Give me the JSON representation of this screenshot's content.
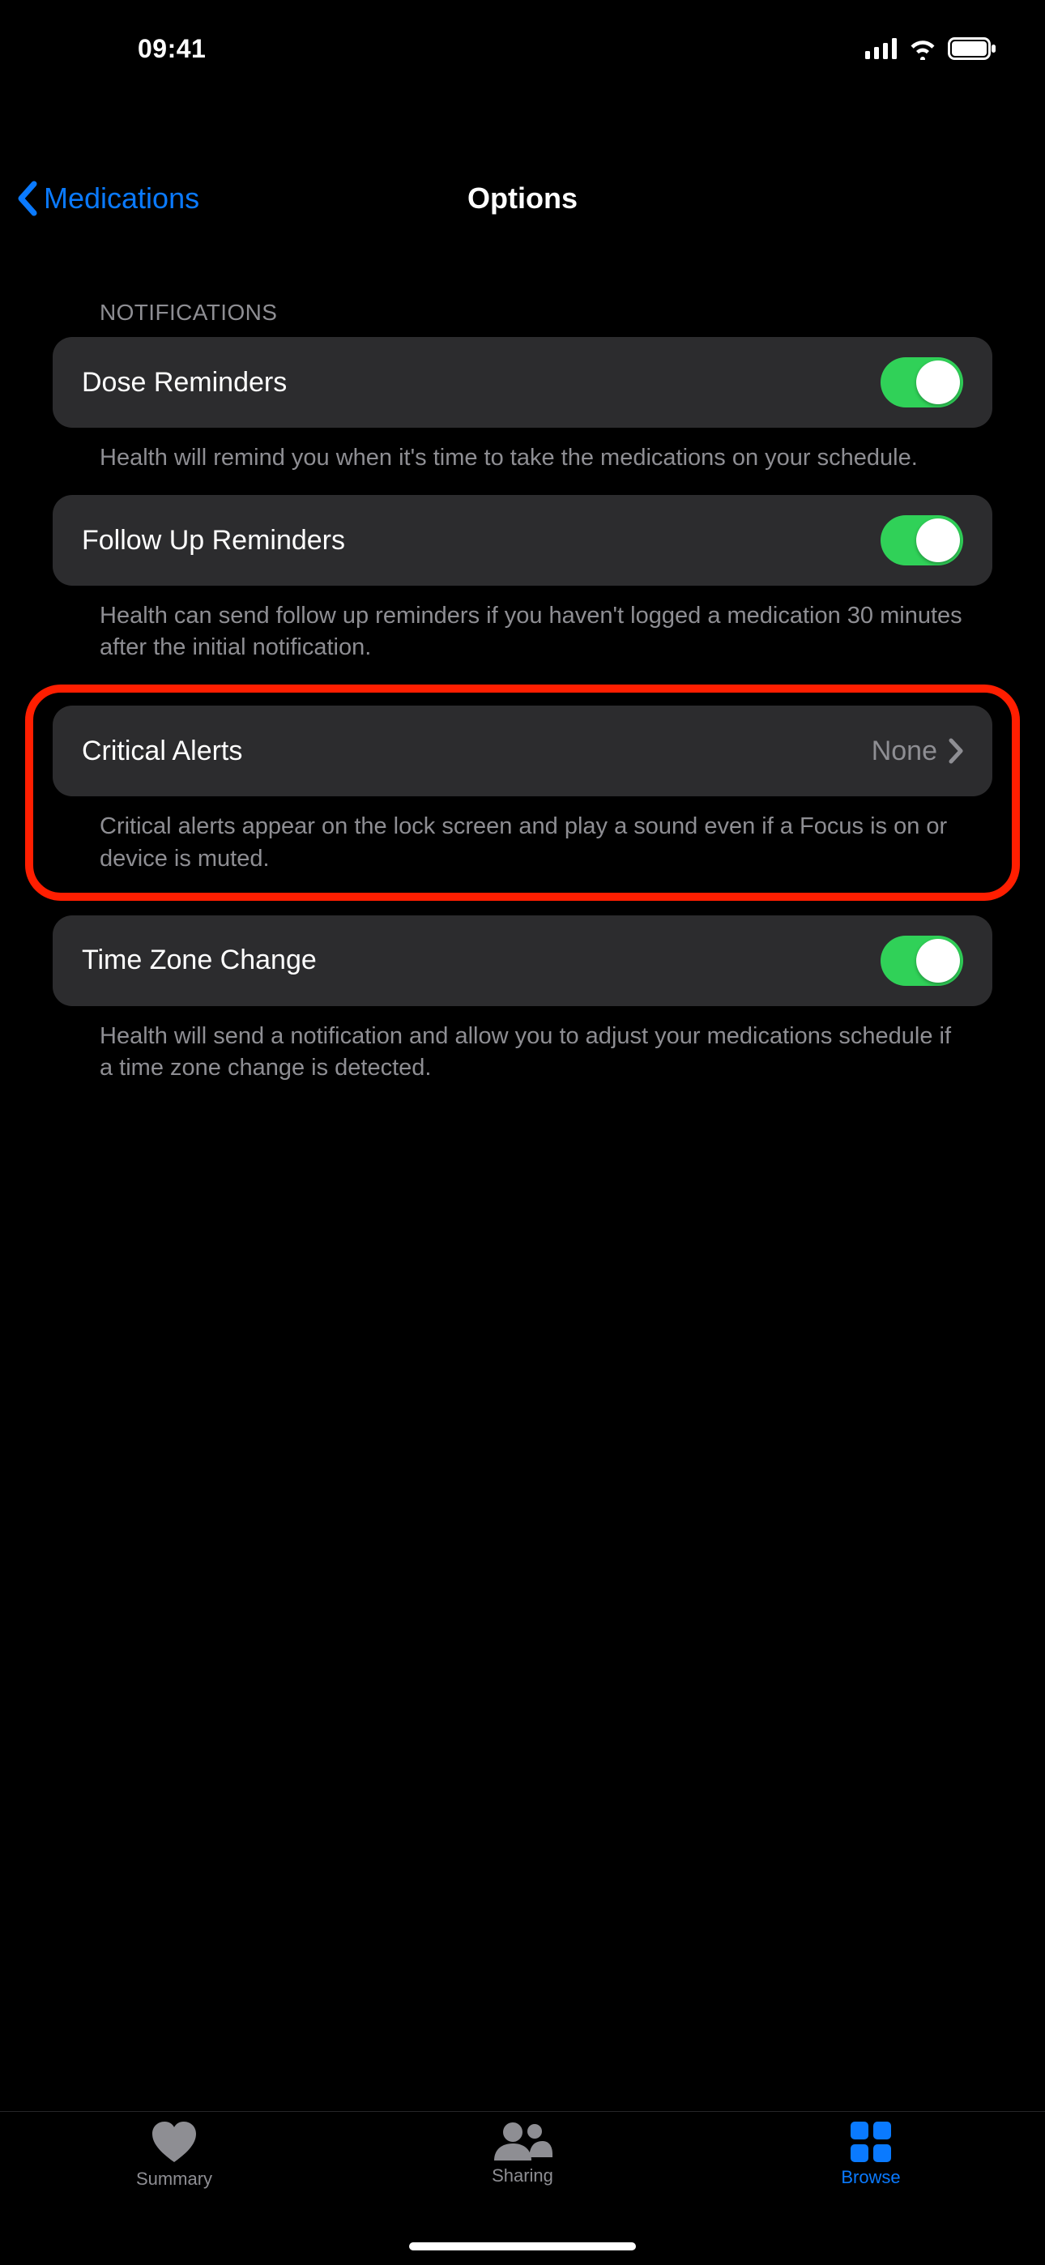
{
  "status": {
    "time": "09:41"
  },
  "nav": {
    "back_label": "Medications",
    "title": "Options"
  },
  "section": {
    "title": "NOTIFICATIONS"
  },
  "rows": {
    "dose_reminders": {
      "label": "Dose Reminders",
      "on": true,
      "footer": "Health will remind you when it's time to take the medications on your schedule."
    },
    "follow_up": {
      "label": "Follow Up Reminders",
      "on": true,
      "footer": "Health can send follow up reminders if you haven't logged a medication 30 minutes after the initial notification."
    },
    "critical_alerts": {
      "label": "Critical Alerts",
      "value": "None",
      "footer": "Critical alerts appear on the lock screen and play a sound even if a Focus is on or device is muted."
    },
    "time_zone": {
      "label": "Time Zone Change",
      "on": true,
      "footer": "Health will send a notification and allow you to adjust your medications schedule if a time zone change is detected."
    }
  },
  "tabs": {
    "summary": "Summary",
    "sharing": "Sharing",
    "browse": "Browse"
  },
  "colors": {
    "accent": "#0a7aff",
    "toggle_on": "#30d158",
    "cell_bg": "#2c2c2e",
    "secondary": "#8e8e93",
    "highlight": "#ff1e00"
  }
}
